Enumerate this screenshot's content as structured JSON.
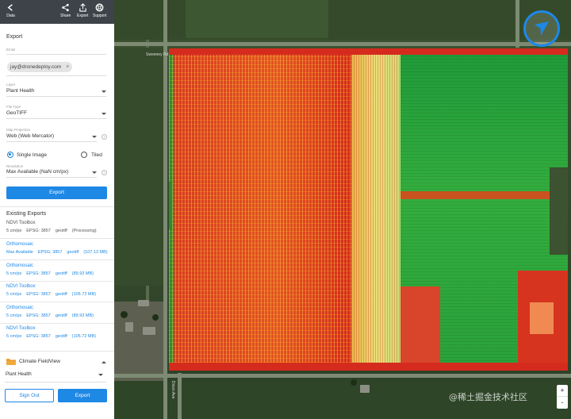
{
  "toolbar": {
    "back_label": "Data",
    "share_label": "Share",
    "export_label": "Export",
    "support_label": "Support"
  },
  "export_form": {
    "title": "Export",
    "email_label": "Email",
    "email_chip": "jay@dronedeploy.com",
    "layer_label": "Layer",
    "layer_value": "Plant Health",
    "file_type_label": "File Type",
    "file_type_value": "GeoTIFF",
    "projection_label": "Map Projection",
    "projection_value": "Web (Web Mercator)",
    "single_image_label": "Single Image",
    "tiled_label": "Tiled",
    "resolution_label": "Resolution",
    "resolution_value": "Max Available (NaN cm/px)",
    "export_button": "Export"
  },
  "existing_exports": {
    "title": "Existing Exports",
    "items": [
      {
        "name": "NDVI Toolbox",
        "res": "5 cm/px",
        "epsg": "EPSG:  3857",
        "format": "geotiff",
        "size": "(Processing)"
      },
      {
        "name": "Orthomosaic",
        "res": "Max Available",
        "epsg": "EPSG:  3857",
        "format": "geotiff",
        "size": "(107.13 MB)"
      },
      {
        "name": "Orthomosaic",
        "res": "5 cm/px",
        "epsg": "EPSG:  3857",
        "format": "geotiff",
        "size": "(89.93 MB)"
      },
      {
        "name": "NDVI Toolbox",
        "res": "5 cm/px",
        "epsg": "EPSG:  3857",
        "format": "geotiff",
        "size": "(105.72 MB)"
      },
      {
        "name": "Orthomosaic",
        "res": "5 cm/px",
        "epsg": "EPSG:  3857",
        "format": "geotiff",
        "size": "(89.93 MB)"
      },
      {
        "name": "NDVI Toolbox",
        "res": "5 cm/px",
        "epsg": "EPSG:  3857",
        "format": "geotiff",
        "size": "(105.72 MB)"
      }
    ]
  },
  "climate": {
    "title": "Climate FieldView",
    "layer_value": "Plant Health",
    "sign_out": "Sign Out",
    "export_button": "Export"
  },
  "map": {
    "road_names": [
      "Sweeney Rd",
      "Dixon Ave"
    ],
    "zoom_in": "+",
    "zoom_out": "-",
    "watermark": "@稀土掘金技术社区"
  },
  "colors": {
    "accent": "#1e88e5",
    "toolbar_bg": "#3d4348",
    "ndvi_high": "#2aa23a",
    "ndvi_low": "#d52b1e"
  }
}
